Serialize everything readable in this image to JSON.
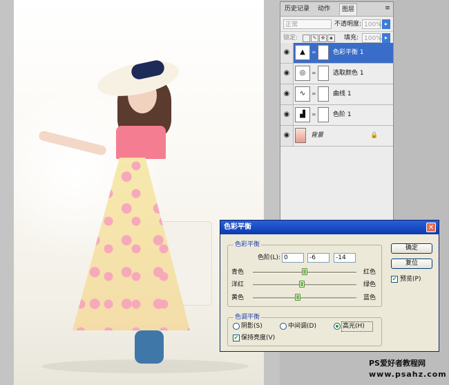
{
  "layers_panel": {
    "tabs": [
      "历史记录",
      "动作",
      "图层"
    ],
    "active_tab": "图层",
    "blend_mode": "正常",
    "opacity_label": "不透明度:",
    "opacity_value": "100%",
    "lock_label": "锁定:",
    "fill_label": "填充:",
    "fill_value": "100%",
    "layers": [
      {
        "name": "色彩平衡 1",
        "icon": "color-balance-adjustment-icon",
        "selected": true
      },
      {
        "name": "选取颜色 1",
        "icon": "selective-color-adjustment-icon",
        "selected": false
      },
      {
        "name": "曲线 1",
        "icon": "curves-adjustment-icon",
        "selected": false
      },
      {
        "name": "色阶 1",
        "icon": "levels-adjustment-icon",
        "selected": false
      },
      {
        "name": "背景",
        "icon": "background-photo-thumbnail",
        "selected": false
      }
    ]
  },
  "dialog": {
    "title": "色彩平衡",
    "color_balance_group": "色彩平衡",
    "levels_label": "色阶(L):",
    "levels_values": [
      "0",
      "-6",
      "-14"
    ],
    "sliders": [
      {
        "left": "青色",
        "right": "红色",
        "value": 0
      },
      {
        "left": "洋红",
        "right": "绿色",
        "value": -6
      },
      {
        "left": "黄色",
        "right": "蓝色",
        "value": -14
      }
    ],
    "tone_group": "色调平衡",
    "tones": [
      {
        "label": "阴影(S)",
        "selected": false
      },
      {
        "label": "中间调(D)",
        "selected": false
      },
      {
        "label": "高光(H)",
        "selected": true
      }
    ],
    "preserve_luminosity": "保持亮度(V)",
    "preserve_checked": true,
    "ok_label": "确定",
    "reset_label": "复位",
    "preview_label": "预览(P)",
    "preview_checked": true
  },
  "watermark": {
    "line1": "PS爱好者教程网",
    "line2": "www.psahz.com"
  },
  "colors": {
    "selected_layer": "#3a6dca",
    "titlebar": "#0b3ab0",
    "dialog_bg": "#ece9d8"
  }
}
